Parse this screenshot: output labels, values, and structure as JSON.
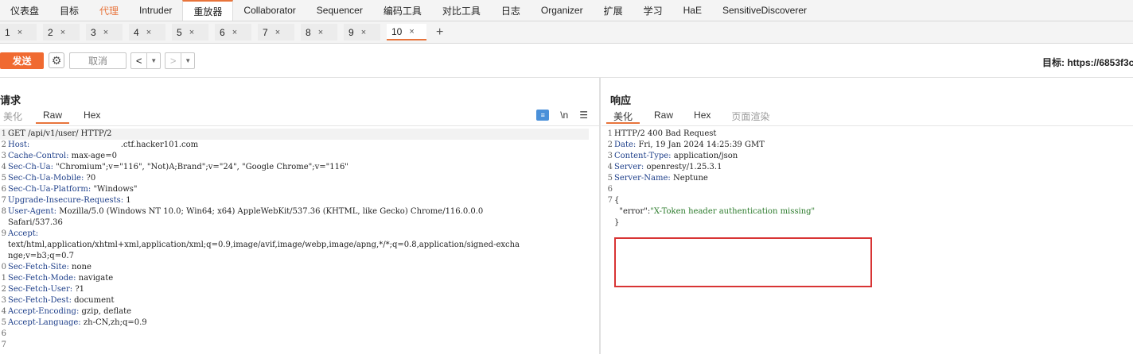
{
  "topnav": [
    {
      "label": "仪表盘"
    },
    {
      "label": "目标"
    },
    {
      "label": "代理",
      "style": "orange"
    },
    {
      "label": "Intruder"
    },
    {
      "label": "重放器",
      "style": "active"
    },
    {
      "label": "Collaborator"
    },
    {
      "label": "Sequencer"
    },
    {
      "label": "编码工具"
    },
    {
      "label": "对比工具"
    },
    {
      "label": "日志"
    },
    {
      "label": "Organizer"
    },
    {
      "label": "扩展"
    },
    {
      "label": "学习"
    },
    {
      "label": "HaE"
    },
    {
      "label": "SensitiveDiscoverer"
    }
  ],
  "subtabs": [
    "1",
    "2",
    "3",
    "4",
    "5",
    "6",
    "7",
    "8",
    "9",
    "10"
  ],
  "active_subtab": "10",
  "toolbar": {
    "send": "发送",
    "cancel": "取消",
    "target": "目标: https://6853f3c"
  },
  "request": {
    "title": "请求",
    "tabs": [
      "美化",
      "Raw",
      "Hex"
    ],
    "active_tab": "Raw",
    "lines": [
      {
        "n": "1",
        "k": "",
        "v": "GET /api/v1/user/ HTTP/2"
      },
      {
        "n": "2",
        "k": "Host:",
        "v": "                                   .ctf.hacker101.com"
      },
      {
        "n": "3",
        "k": "Cache-Control:",
        "v": "max-age=0"
      },
      {
        "n": "4",
        "k": "Sec-Ch-Ua:",
        "v": "\"Chromium\";v=\"116\", \"Not)A;Brand\";v=\"24\", \"Google Chrome\";v=\"116\""
      },
      {
        "n": "5",
        "k": "Sec-Ch-Ua-Mobile:",
        "v": "?0"
      },
      {
        "n": "6",
        "k": "Sec-Ch-Ua-Platform:",
        "v": "\"Windows\""
      },
      {
        "n": "7",
        "k": "Upgrade-Insecure-Requests:",
        "v": "1"
      },
      {
        "n": "8",
        "k": "User-Agent:",
        "v": "Mozilla/5.0 (Windows NT 10.0; Win64; x64) AppleWebKit/537.36 (KHTML, like Gecko) Chrome/116.0.0.0"
      },
      {
        "n": "",
        "k": "",
        "v": "Safari/537.36"
      },
      {
        "n": "9",
        "k": "Accept:",
        "v": ""
      },
      {
        "n": "",
        "k": "",
        "v": "text/html,application/xhtml+xml,application/xml;q=0.9,image/avif,image/webp,image/apng,*/*;q=0.8,application/signed-excha"
      },
      {
        "n": "",
        "k": "",
        "v": "nge;v=b3;q=0.7"
      },
      {
        "n": "0",
        "k": "Sec-Fetch-Site:",
        "v": "none"
      },
      {
        "n": "1",
        "k": "Sec-Fetch-Mode:",
        "v": "navigate"
      },
      {
        "n": "2",
        "k": "Sec-Fetch-User:",
        "v": "?1"
      },
      {
        "n": "3",
        "k": "Sec-Fetch-Dest:",
        "v": "document"
      },
      {
        "n": "4",
        "k": "Accept-Encoding:",
        "v": "gzip, deflate"
      },
      {
        "n": "5",
        "k": "Accept-Language:",
        "v": "zh-CN,zh;q=0.9"
      },
      {
        "n": "6",
        "k": "",
        "v": ""
      },
      {
        "n": "7",
        "k": "",
        "v": ""
      }
    ]
  },
  "response": {
    "title": "响应",
    "tabs": [
      "美化",
      "Raw",
      "Hex",
      "页面渲染"
    ],
    "active_tab": "美化",
    "lines": [
      {
        "n": "1",
        "k": "",
        "v": "HTTP/2 400 Bad Request"
      },
      {
        "n": "2",
        "k": "Date:",
        "v": "Fri, 19 Jan 2024 14:25:39 GMT"
      },
      {
        "n": "3",
        "k": "Content-Type:",
        "v": "application/json"
      },
      {
        "n": "4",
        "k": "Server:",
        "v": "openresty/1.25.3.1"
      },
      {
        "n": "5",
        "k": "Server-Name:",
        "v": "Neptune"
      },
      {
        "n": "6",
        "k": "",
        "v": ""
      },
      {
        "n": "7",
        "k": "",
        "v": "{"
      },
      {
        "n": "",
        "k": "",
        "v": "  \"error\":",
        "s": "\"X-Token header authentication missing\""
      },
      {
        "n": "",
        "k": "",
        "v": "}"
      }
    ]
  },
  "editor_icons": {
    "wrap": "wrap-icon",
    "newline": "\\n",
    "menu": "☰"
  }
}
